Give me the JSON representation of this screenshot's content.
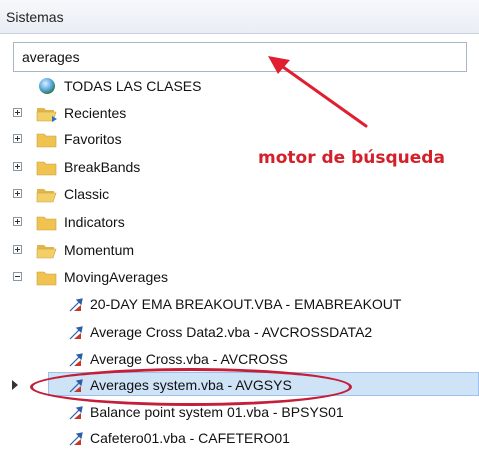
{
  "panel": {
    "title": "Sistemas"
  },
  "search": {
    "value": "averages"
  },
  "tree": {
    "all_classes": "TODAS LAS CLASES",
    "folders": [
      {
        "label": "Recientes",
        "state": "collapsed"
      },
      {
        "label": "Favoritos",
        "state": "collapsed"
      },
      {
        "label": "BreakBands",
        "state": "collapsed"
      },
      {
        "label": "Classic",
        "state": "collapsed"
      },
      {
        "label": "Indicators",
        "state": "collapsed"
      },
      {
        "label": "Momentum",
        "state": "collapsed"
      },
      {
        "label": "MovingAverages",
        "state": "expanded"
      }
    ],
    "items": [
      {
        "label": "20-DAY EMA BREAKOUT.VBA - EMABREAKOUT"
      },
      {
        "label": "Average Cross Data2.vba - AVCROSSDATA2"
      },
      {
        "label": "Average Cross.vba - AVCROSS"
      },
      {
        "label": "Averages system.vba - AVGSYS"
      },
      {
        "label": "Balance point system 01.vba - BPSYS01"
      },
      {
        "label": "Cafetero01.vba - CAFETERO01"
      }
    ],
    "selected_item": "Averages system.vba - AVGSYS"
  },
  "annotation": {
    "text": "motor de búsqueda",
    "color": "#d4202a"
  },
  "colors": {
    "selection": "#cfe3f7",
    "folder": "#f0c24f",
    "highlight_ring": "#c41f3a"
  },
  "icons": [
    "globe-icon",
    "folder-icon",
    "class-arrows-icon",
    "expander-plus-icon",
    "expander-minus-icon"
  ]
}
